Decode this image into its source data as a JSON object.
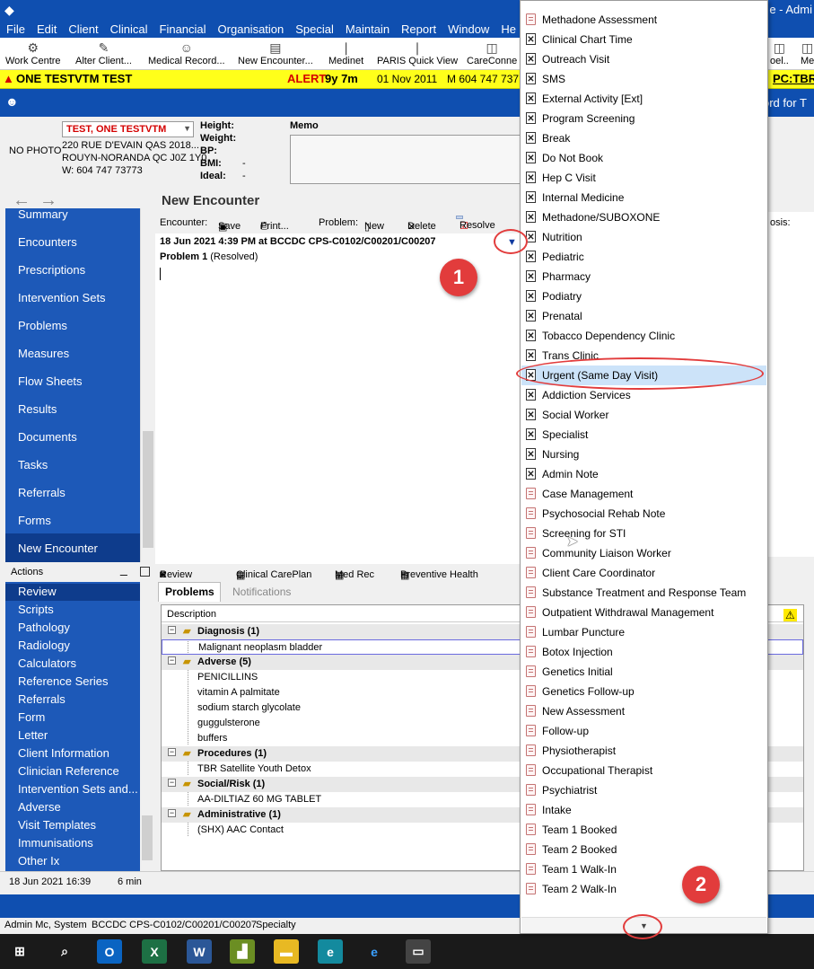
{
  "window": {
    "title_right": "e - Admi"
  },
  "menu": [
    "File",
    "Edit",
    "Client",
    "Clinical",
    "Financial",
    "Organisation",
    "Special",
    "Maintain",
    "Report",
    "Window",
    "He"
  ],
  "toolbar": [
    {
      "label": "Work Centre",
      "icon": "work-centre-icon"
    },
    {
      "label": "Alter Client...",
      "icon": "alter-client-icon"
    },
    {
      "label": "Medical Record...",
      "icon": "medical-record-icon"
    },
    {
      "label": "New Encounter...",
      "icon": "new-encounter-icon"
    },
    {
      "label": "Medinet",
      "icon": "medinet-icon"
    },
    {
      "label": "PARIS Quick View",
      "icon": "quick-view-icon"
    },
    {
      "label": "CareConne",
      "icon": "care-connect-icon"
    },
    {
      "label": "oel..",
      "icon": "tool-icon"
    },
    {
      "label": "Me",
      "icon": "tool-icon"
    }
  ],
  "alert": {
    "patient": "ONE TESTVTM TEST",
    "alert_label": "ALERT",
    "age": "9y 7m",
    "date": "01 Nov 2011",
    "phone": "M 604 747 737",
    "pc": "PC:",
    "pc_val": "TBR"
  },
  "bluebar": {
    "right": "ord for T"
  },
  "patient": {
    "photo": "NO PHOTO",
    "name": "TEST, ONE TESTVTM",
    "addr1": "220 RUE D'EVAIN QAS 2018...",
    "addr2": "ROUYN-NORANDA QC J0Z 1Y0",
    "phone": "W: 604 747 73773",
    "vitals": [
      {
        "label": "Height:",
        "value": ""
      },
      {
        "label": "Weight:",
        "value": ""
      },
      {
        "label": "BP:",
        "value": ""
      },
      {
        "label": "BMI:",
        "value": "-"
      },
      {
        "label": "Ideal:",
        "value": "-"
      }
    ],
    "memo": "Memo"
  },
  "page_title": "New Encounter",
  "sidebar": [
    "Summary",
    "Encounters",
    "Prescriptions",
    "Intervention Sets",
    "Problems",
    "Measures",
    "Flow Sheets",
    "Results",
    "Documents",
    "Tasks",
    "Referrals",
    "Forms",
    "New Encounter"
  ],
  "actions_title": "Actions",
  "actions": [
    "Review",
    "Scripts",
    "Pathology",
    "Radiology",
    "Calculators",
    "Reference Series",
    "Referrals",
    "Form",
    "Letter",
    "Client Information",
    "Clinician Reference",
    "Intervention Sets and...",
    "Adverse",
    "Visit Templates",
    "Immunisations",
    "Other Ix"
  ],
  "encounter_toolbar": {
    "encounter": "Encounter:",
    "save": "Save",
    "print": "Print...",
    "problem": "Problem:",
    "new": "New",
    "delete": "Delete",
    "resolve": "Resolve"
  },
  "encounter": {
    "header": "18 Jun 2021 4:39 PM at BCCDC CPS-C0102/C00201/C00207",
    "problem": "Problem 1",
    "status": "(Resolved)"
  },
  "review_tabs": [
    "Review",
    "Clinical CarePlan",
    "Med Rec",
    "Preventive Health"
  ],
  "problem_tabs": {
    "active": "Problems",
    "inactive": "Notifications"
  },
  "problems": {
    "header": "Description",
    "groups": [
      {
        "name": "Diagnosis (1)",
        "items": [
          "Malignant neoplasm bladder"
        ]
      },
      {
        "name": "Adverse (5)",
        "items": [
          "PENICILLINS",
          "vitamin A palmitate",
          "sodium starch glycolate",
          "guggulsterone",
          "buffers"
        ]
      },
      {
        "name": "Procedures (1)",
        "items": [
          "TBR Satellite Youth Detox"
        ]
      },
      {
        "name": "Social/Risk (1)",
        "items": [
          "AA-DILTIAZ 60 MG TABLET"
        ]
      },
      {
        "name": "Administrative (1)",
        "items": [
          "(SHX) AAC Contact"
        ]
      }
    ]
  },
  "status1": {
    "date": "18 Jun 2021 16:39",
    "dur": "6 min"
  },
  "status2": {
    "user": "Admin Mc, System",
    "loc": "BCCDC CPS-C0102/C00201/C00207",
    "spec": "Specialty"
  },
  "right_strip": "osis:",
  "dropdown": {
    "items": [
      {
        "label": "Methadone Assessment",
        "icon": "doc"
      },
      {
        "label": "Clinical Chart Time",
        "icon": "x"
      },
      {
        "label": "Outreach Visit",
        "icon": "x"
      },
      {
        "label": "SMS",
        "icon": "x"
      },
      {
        "label": "External Activity [Ext]",
        "icon": "x"
      },
      {
        "label": "Program Screening",
        "icon": "x"
      },
      {
        "label": "Break",
        "icon": "x"
      },
      {
        "label": "Do Not Book",
        "icon": "x"
      },
      {
        "label": "Hep C Visit",
        "icon": "x"
      },
      {
        "label": "Internal Medicine",
        "icon": "x"
      },
      {
        "label": "Methadone/SUBOXONE",
        "icon": "x"
      },
      {
        "label": "Nutrition",
        "icon": "x"
      },
      {
        "label": "Pediatric",
        "icon": "x"
      },
      {
        "label": "Pharmacy",
        "icon": "x"
      },
      {
        "label": "Podiatry",
        "icon": "x"
      },
      {
        "label": "Prenatal",
        "icon": "x"
      },
      {
        "label": "Tobacco Dependency Clinic",
        "icon": "x"
      },
      {
        "label": "Trans Clinic",
        "icon": "x"
      },
      {
        "label": "Urgent (Same Day Visit)",
        "icon": "x",
        "selected": true
      },
      {
        "label": "Addiction Services",
        "icon": "x"
      },
      {
        "label": "Social Worker",
        "icon": "x"
      },
      {
        "label": "Specialist",
        "icon": "x"
      },
      {
        "label": "Nursing",
        "icon": "x"
      },
      {
        "label": "Admin Note",
        "icon": "x"
      },
      {
        "label": "Case Management",
        "icon": "doc"
      },
      {
        "label": "Psychosocial Rehab Note",
        "icon": "doc"
      },
      {
        "label": "Screening for STI",
        "icon": "doc"
      },
      {
        "label": "Community Liaison Worker",
        "icon": "doc"
      },
      {
        "label": "Client Care Coordinator",
        "icon": "doc"
      },
      {
        "label": "Substance Treatment and Response Team",
        "icon": "doc"
      },
      {
        "label": "Outpatient Withdrawal Management",
        "icon": "doc"
      },
      {
        "label": "Lumbar Puncture",
        "icon": "doc"
      },
      {
        "label": "Botox Injection",
        "icon": "doc"
      },
      {
        "label": "Genetics Initial",
        "icon": "doc"
      },
      {
        "label": "Genetics Follow-up",
        "icon": "doc"
      },
      {
        "label": "New Assessment",
        "icon": "doc"
      },
      {
        "label": "Follow-up",
        "icon": "doc"
      },
      {
        "label": "Physiotherapist",
        "icon": "doc"
      },
      {
        "label": "Occupational Therapist",
        "icon": "doc"
      },
      {
        "label": "Psychiatrist",
        "icon": "doc"
      },
      {
        "label": "Intake",
        "icon": "doc"
      },
      {
        "label": "Team 1 Booked",
        "icon": "doc"
      },
      {
        "label": "Team 2 Booked",
        "icon": "doc"
      },
      {
        "label": "Team 1 Walk-In",
        "icon": "doc"
      },
      {
        "label": "Team 2 Walk-In",
        "icon": "doc"
      }
    ]
  },
  "annotations": {
    "one": "1",
    "two": "2"
  },
  "colors": {
    "brand_blue": "#1d59b8",
    "title_blue": "#0f4fb0",
    "alert_yellow": "#ffff1a",
    "annotation_red": "#e23c3c"
  }
}
